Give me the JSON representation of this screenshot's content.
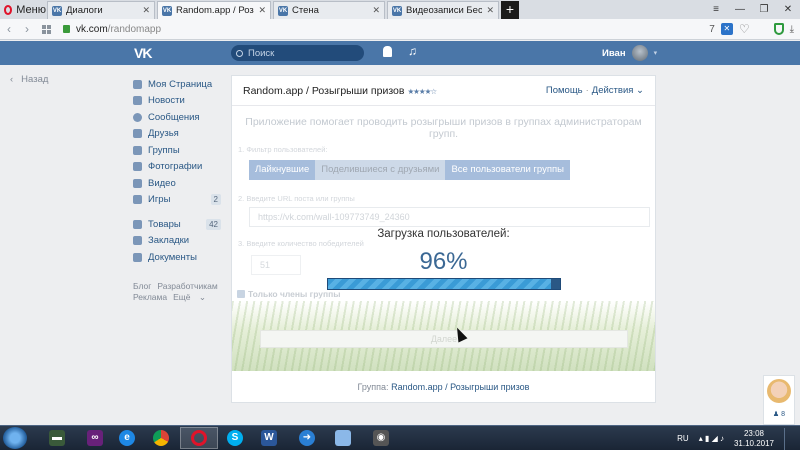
{
  "browser": {
    "menu_label": "Меню",
    "tabs": [
      {
        "title": "Диалоги",
        "active": false
      },
      {
        "title": "Random.app / Розыгрыши",
        "active": true
      },
      {
        "title": "Стена",
        "active": false
      },
      {
        "title": "Видеозаписи Бесплатный",
        "active": false
      }
    ],
    "new_tab": "+",
    "url_domain": "vk.com",
    "url_path": "/randomapp",
    "adblock_count": "7"
  },
  "vk_header": {
    "logo": "VK",
    "search_placeholder": "Поиск",
    "user_name": "Иван"
  },
  "leftnav": {
    "back_label": "Назад",
    "items": [
      {
        "label": "Моя Страница",
        "count": ""
      },
      {
        "label": "Новости",
        "count": ""
      },
      {
        "label": "Сообщения",
        "count": ""
      },
      {
        "label": "Друзья",
        "count": ""
      },
      {
        "label": "Группы",
        "count": ""
      },
      {
        "label": "Фотографии",
        "count": ""
      },
      {
        "label": "Видео",
        "count": ""
      },
      {
        "label": "Игры",
        "count": "2"
      }
    ],
    "items2": [
      {
        "label": "Товары",
        "count": "42"
      },
      {
        "label": "Закладки",
        "count": ""
      },
      {
        "label": "Документы",
        "count": ""
      }
    ],
    "footer": {
      "blog": "Блог",
      "developers": "Разработчикам",
      "ads": "Реклама",
      "more": "Ещё"
    }
  },
  "app": {
    "title": "Random.app / Розыгрыши призов",
    "stars": "★★★★☆",
    "help": "Помощь",
    "actions": "Действия",
    "description": "Приложение помогает проводить розыгрыши призов в группах администраторам групп.",
    "step1": "1. Фильтр пользователей:",
    "filters": [
      "Лайкнувшие",
      "Поделившиеся с друзьями",
      "Все пользователи группы"
    ],
    "selected_filter_index": 1,
    "step2": "2. Введите URL поста или группы",
    "post_url": "https://vk.com/wall-109773749_24360",
    "step3": "3. Введите количество победителей",
    "winners_count": "51",
    "only_members": "Только члены группы",
    "next_button": "Далее",
    "loading_label": "Загрузка пользователей:",
    "loading_percent_text": "96%",
    "loading_progress": 0.96,
    "footer_prefix": "Группа:",
    "footer_link": "Random.app / Розыгрыши призов"
  },
  "chat_widget": {
    "count": "8"
  },
  "taskbar": {
    "lang": "RU",
    "time": "23:08",
    "date": "31.10.2017"
  }
}
